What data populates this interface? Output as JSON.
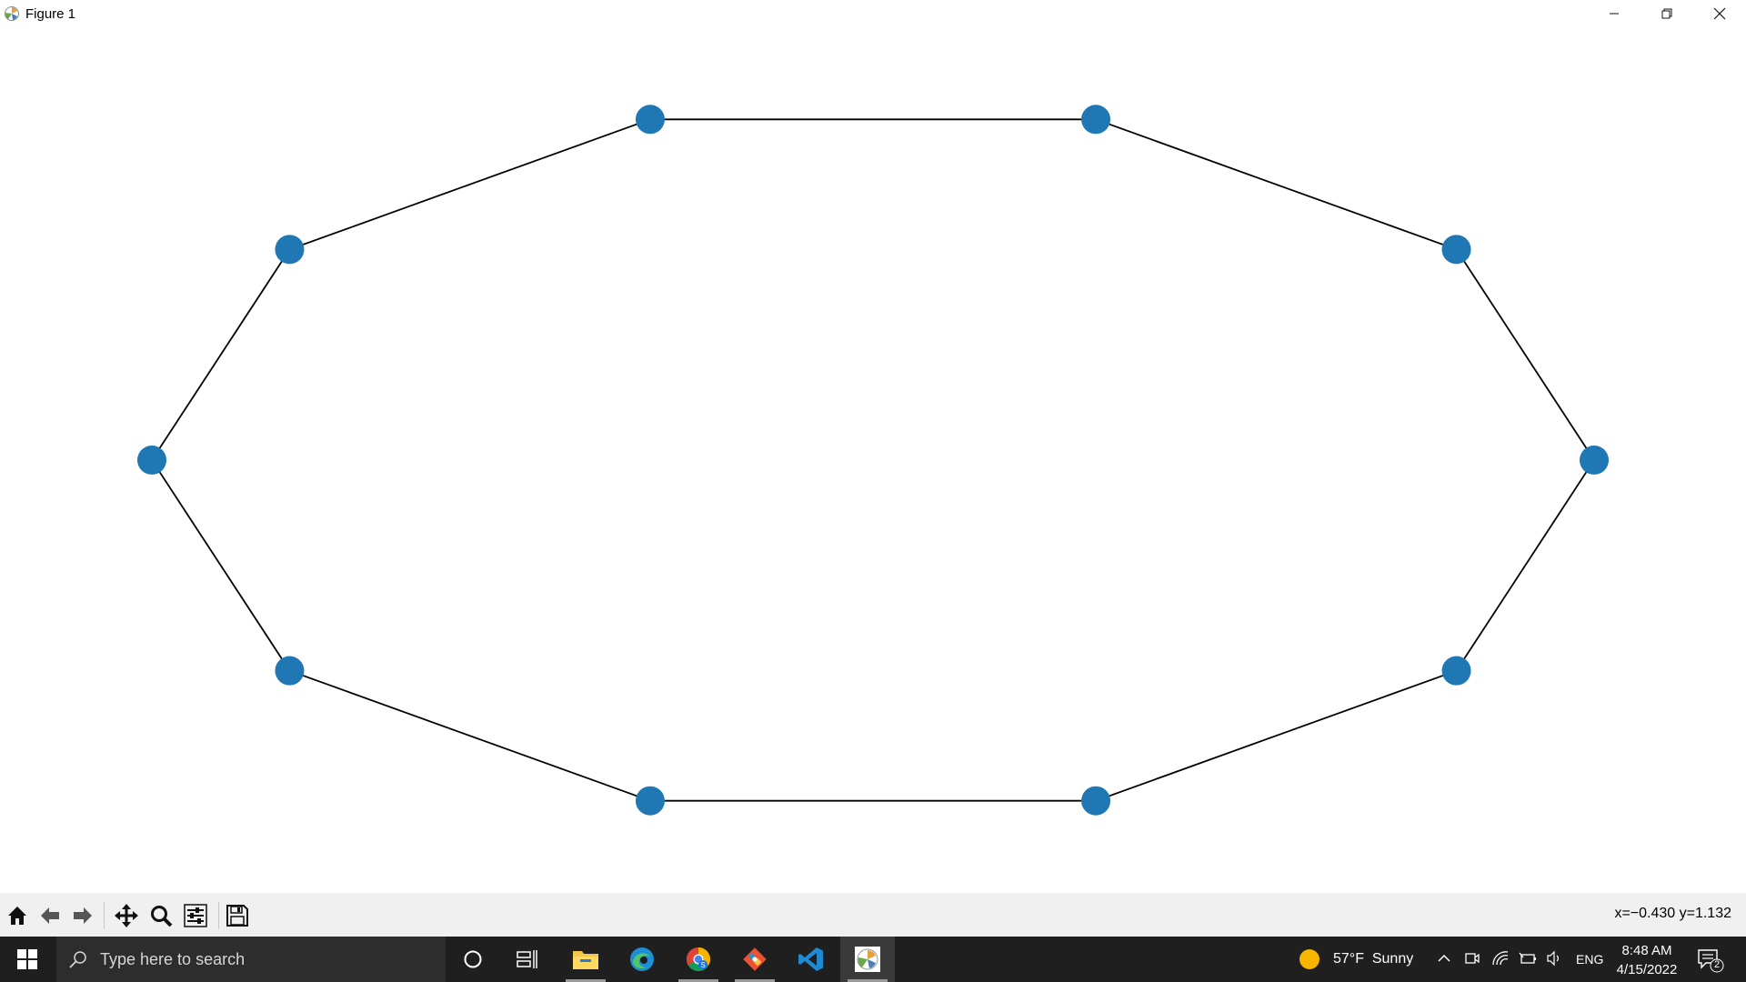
{
  "window": {
    "title": "Figure 1",
    "controls": [
      "minimize-icon",
      "restore-icon",
      "close-icon"
    ]
  },
  "chart_data": {
    "type": "graph",
    "title": "",
    "node_color": "#1f77b4",
    "edge_color": "#000000",
    "nodes": [
      {
        "id": 0,
        "x": 1.0,
        "y": 0.0
      },
      {
        "id": 1,
        "x": 0.809,
        "y": 0.588
      },
      {
        "id": 2,
        "x": 0.309,
        "y": 0.951
      },
      {
        "id": 3,
        "x": -0.309,
        "y": 0.951
      },
      {
        "id": 4,
        "x": -0.809,
        "y": 0.588
      },
      {
        "id": 5,
        "x": -1.0,
        "y": 0.0
      },
      {
        "id": 6,
        "x": -0.809,
        "y": -0.588
      },
      {
        "id": 7,
        "x": -0.309,
        "y": -0.951
      },
      {
        "id": 8,
        "x": 0.309,
        "y": -0.951
      },
      {
        "id": 9,
        "x": 0.809,
        "y": -0.588
      }
    ],
    "edges": [
      [
        0,
        1
      ],
      [
        1,
        2
      ],
      [
        2,
        3
      ],
      [
        3,
        4
      ],
      [
        4,
        5
      ],
      [
        5,
        6
      ],
      [
        6,
        7
      ],
      [
        7,
        8
      ],
      [
        8,
        9
      ],
      [
        9,
        0
      ]
    ]
  },
  "toolbar": {
    "buttons": [
      "home-icon",
      "back-icon",
      "forward-icon",
      "pan-icon",
      "zoom-icon",
      "configure-subplots-icon",
      "save-icon"
    ],
    "coords": "x=−0.430 y=1.132"
  },
  "taskbar": {
    "search_placeholder": "Type here to search",
    "apps": [
      "cortana-icon",
      "task-view-icon",
      "file-explorer-icon",
      "edge-icon",
      "chrome-icon",
      "git-icon",
      "vscode-icon",
      "matplotlib-icon"
    ],
    "weather": "57°F  Sunny",
    "language": "ENG",
    "time": "8:48 AM",
    "date": "4/15/2022",
    "notification_count": "2"
  }
}
